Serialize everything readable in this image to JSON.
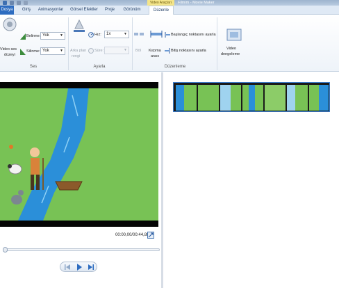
{
  "window": {
    "context_tab": "Video Araçları",
    "title": "Filmim - Movie Maker"
  },
  "tabs": {
    "file": "Dosya",
    "items": [
      "Giriş",
      "Animasyonlar",
      "Görsel Efektler",
      "Proje",
      "Görünüm",
      "Düzenle"
    ],
    "active": "Düzenle"
  },
  "ribbon": {
    "audio": {
      "volume_label_1": "Video ses",
      "volume_label_2": "düzeyi",
      "fade_in_label": "Belirme:",
      "fade_in_value": "Yok",
      "fade_out_label": "Silinme:",
      "fade_out_value": "Yok",
      "group_label": "Ses"
    },
    "adjust": {
      "bg_color_label_1": "Arka plan",
      "bg_color_label_2": "rengi",
      "speed_label": "Hız:",
      "speed_value": "1x",
      "duration_label": "Süre:",
      "duration_value": "",
      "group_label": "Ayarla"
    },
    "edit": {
      "split_label": "Böl",
      "trim_label_1": "Kırpma",
      "trim_label_2": "aracı",
      "set_start_label": "Başlangıç noktasını ayarla",
      "set_end_label": "Bitiş noktasını ayarla",
      "group_label": "Düzenleme"
    },
    "stabilize": {
      "label_1": "Video",
      "label_2": "dengeleme"
    }
  },
  "player": {
    "timecode": "00:00,00/00:44,88"
  },
  "colors": {
    "accent": "#2d6cc0",
    "grass": "#78c255",
    "river": "#2b8fd9"
  }
}
